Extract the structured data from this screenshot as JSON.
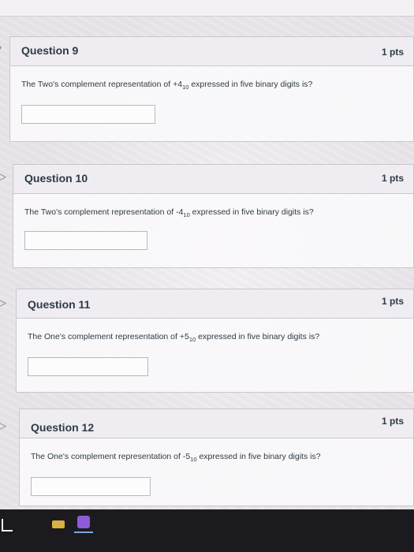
{
  "questions": [
    {
      "title": "Question 9",
      "points": "1 pts",
      "text_before": "The Two's complement representation of +4",
      "subscript": "10",
      "text_after": " expressed in five binary digits is?"
    },
    {
      "title": "Question 10",
      "points": "1 pts",
      "text_before": "The Two's complement representation of -4",
      "subscript": "10",
      "text_after": " expressed in five binary digits is?"
    },
    {
      "title": "Question 11",
      "points": "1 pts",
      "text_before": "The One's complement representation of +5",
      "subscript": "10",
      "text_after": " expressed in five binary digits is?"
    },
    {
      "title": "Question 12",
      "points": "1 pts",
      "text_before": "The One's complement representation of -5",
      "subscript": "10",
      "text_after": " expressed in five binary digits is?"
    }
  ],
  "answers": [
    "",
    "",
    "",
    ""
  ]
}
